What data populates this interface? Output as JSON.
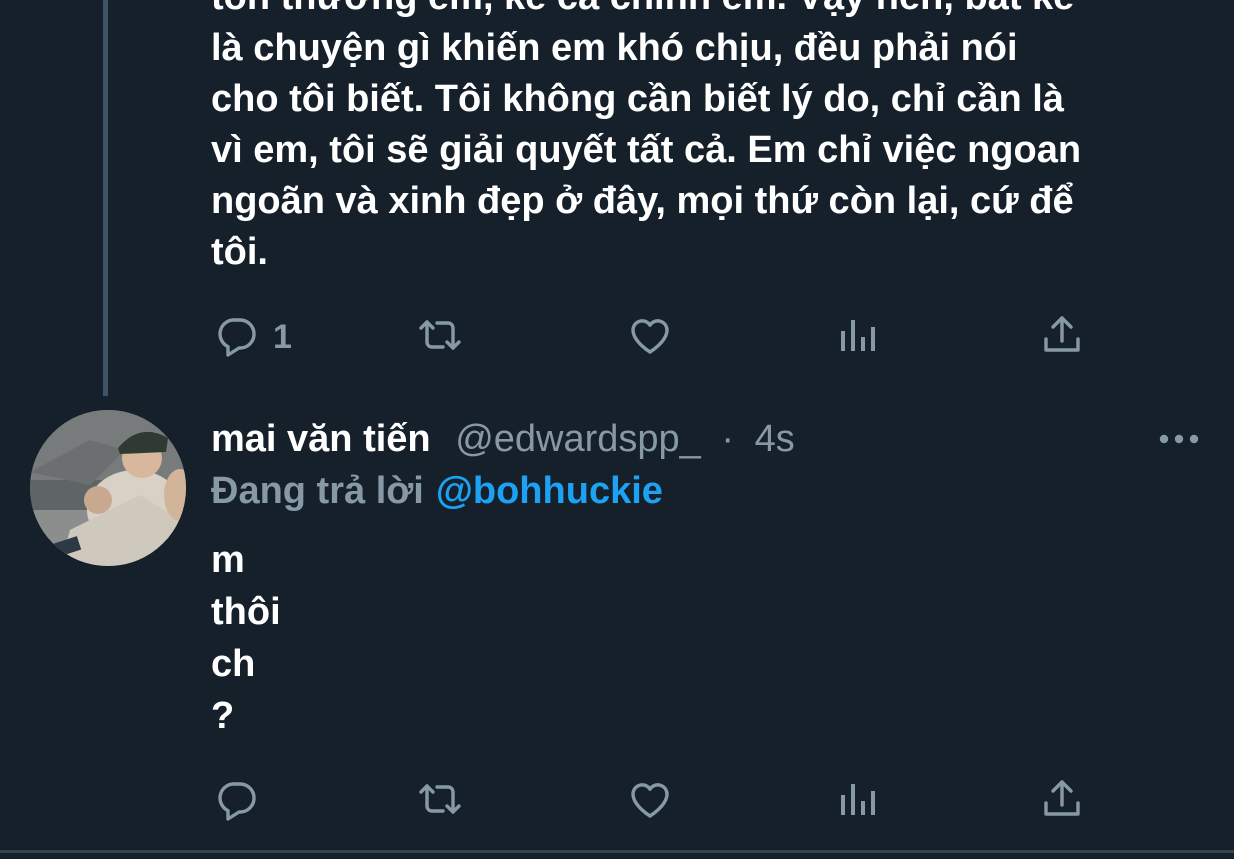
{
  "tweet1": {
    "lines": [
      "tổn thương em, kể cả chính em. Vậy nên, bất kể",
      "là chuyện gì khiến em khó chịu, đều phải nói",
      "cho tôi biết. Tôi không cần biết lý do, chỉ cần là",
      "vì em, tôi sẽ giải quyết tất cả. Em chỉ việc ngoan",
      "ngoãn và xinh đẹp ở đây, mọi thứ còn lại, cứ để",
      "tôi."
    ],
    "reply_count": "1"
  },
  "tweet2": {
    "display_name": "mai văn tiến",
    "handle": "@edwardspp_",
    "separator": "·",
    "time": "4s",
    "replying_prefix": "Đang trả lời",
    "replying_to": "@bohhuckie",
    "lines": [
      "m",
      "thôi",
      "ch",
      "?"
    ],
    "avatar": "user-avatar-photo"
  },
  "icons": {
    "reply": "reply-icon",
    "retweet": "retweet-icon",
    "like": "heart-icon",
    "stats": "analytics-icon",
    "share": "share-icon",
    "more": "more-icon"
  },
  "colors": {
    "background": "#15202b",
    "text": "#ffffff",
    "secondary_text": "#8899a6",
    "accent": "#1da1f2",
    "thread_line": "#3d5466",
    "divider": "#38444d"
  }
}
